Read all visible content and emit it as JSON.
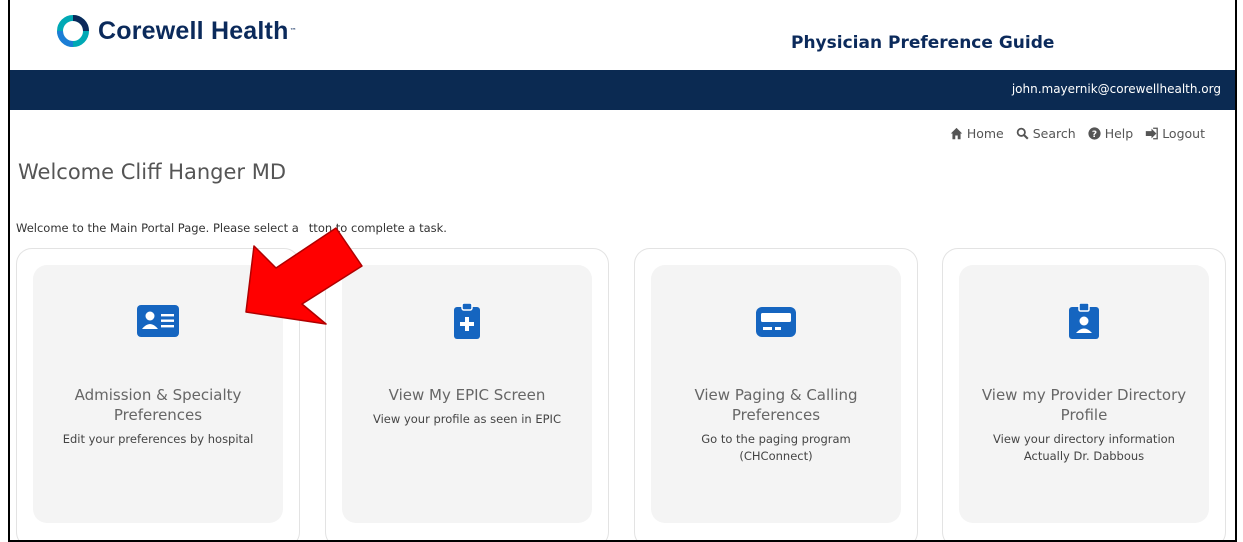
{
  "header": {
    "brand": "Corewell Health",
    "brand_tm": "™",
    "app_title": "Physician Preference Guide"
  },
  "userbar": {
    "email": "john.mayernik@corewellhealth.org"
  },
  "nav": {
    "items": [
      {
        "label": "Home",
        "icon": "home-icon"
      },
      {
        "label": "Search",
        "icon": "search-icon"
      },
      {
        "label": "Help",
        "icon": "help-icon"
      },
      {
        "label": "Logout",
        "icon": "logout-icon"
      }
    ]
  },
  "main": {
    "welcome": "Welcome Cliff Hanger MD",
    "intro_before": "Welcome to the Main Portal Page. Please select a",
    "intro_after": "tton to complete a task."
  },
  "cards": [
    {
      "title_line1": "Admission & Specialty",
      "title_line2": "Preferences",
      "desc_line1": "Edit your preferences by hospital",
      "desc_line2": "",
      "icon": "id-card-icon"
    },
    {
      "title_line1": "View My EPIC Screen",
      "title_line2": "",
      "desc_line1": "View your profile as seen in EPIC",
      "desc_line2": "",
      "icon": "medical-clipboard-icon"
    },
    {
      "title_line1": "View Paging & Calling",
      "title_line2": "Preferences",
      "desc_line1": "Go to the paging program",
      "desc_line2": "(CHConnect)",
      "icon": "pager-icon"
    },
    {
      "title_line1": "View my Provider Directory",
      "title_line2": "Profile",
      "desc_line1": "View your directory information",
      "desc_line2": "Actually Dr. Dabbous",
      "icon": "id-badge-icon"
    }
  ],
  "colors": {
    "navy": "#0b2a52",
    "icon_blue": "#1565c0",
    "arrow_red": "#ff0000"
  }
}
